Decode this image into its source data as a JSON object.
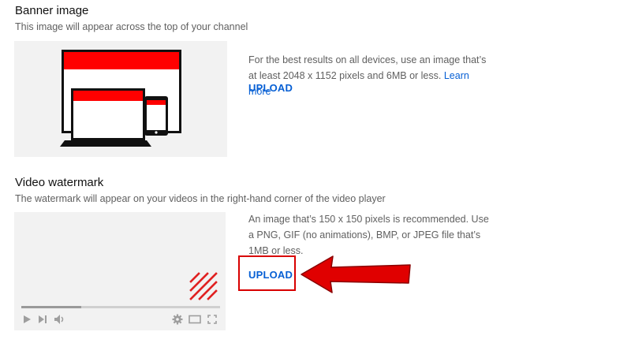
{
  "banner": {
    "title": "Banner image",
    "description": "This image will appear across the top of your channel",
    "info": "For the best results on all devices, use an image that’s at least 2048 x 1152 pixels and 6MB or less.",
    "learn_more": "Learn more",
    "upload_label": "UPLOAD"
  },
  "watermark": {
    "title": "Video watermark",
    "description": "The watermark will appear on your videos in the right-hand corner of the video player",
    "info": "An image that’s 150 x 150 pixels is recommended. Use a PNG, GIF (no animations), BMP, or JPEG file that’s 1MB or less.",
    "upload_label": "UPLOAD",
    "progress_fraction": 0.3
  },
  "colors": {
    "accent": "#065fd4",
    "banner_red": "#ff0000",
    "annotation_red": "#e00000"
  },
  "icons": [
    "play-icon",
    "next-icon",
    "volume-icon",
    "settings-icon",
    "theater-mode-icon",
    "fullscreen-icon"
  ]
}
